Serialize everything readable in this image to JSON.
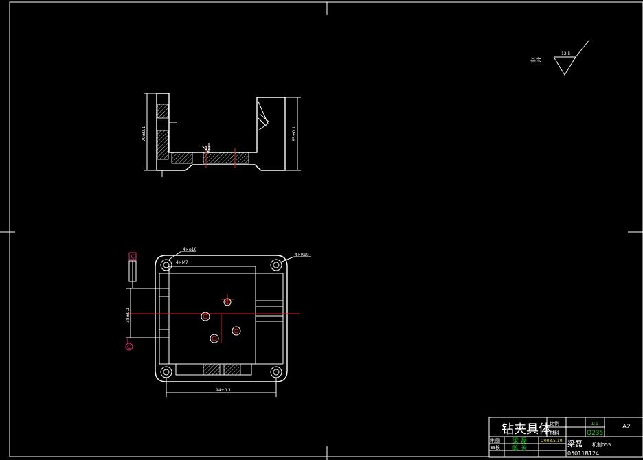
{
  "roughness_note": {
    "prefix": "其余",
    "value": "12.5"
  },
  "front_view": {
    "height_dim_left": "70±0.1",
    "height_dim_right": "65±0.1",
    "surface_mark": "12"
  },
  "top_view": {
    "hole_callout_1": "4×φ10",
    "hole_callout_2": "4×M7",
    "radius_callout": "4×R10",
    "width_dim": "94±0.1",
    "height_dim": "38±0.1",
    "section_label": "C"
  },
  "title_block": {
    "part_name": "钻夹具体",
    "scale_label": "比例",
    "scale_value": "1:1",
    "material_label": "材料",
    "material_value": "Q235",
    "sheet_size": "A2",
    "drawn_label": "制图",
    "drawn_by": "梁 磊",
    "drawn_date": "2008.5.10",
    "checked_label": "审核",
    "checked_by": "陈 芳",
    "school_name": "梁磊",
    "class_name": "机制055",
    "student_id": "05011B124"
  }
}
